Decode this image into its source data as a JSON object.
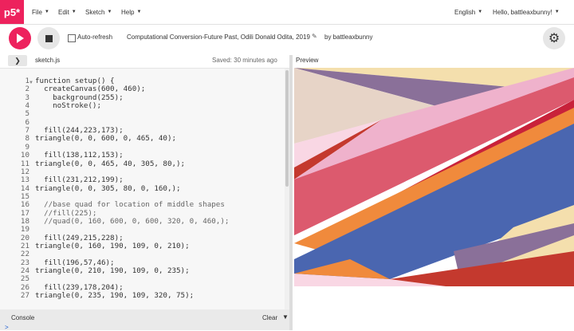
{
  "app": {
    "logo": "p5*"
  },
  "menu": {
    "file": "File",
    "edit": "Edit",
    "sketch": "Sketch",
    "help": "Help",
    "language": "English",
    "user": "Hello, battleaxbunny!"
  },
  "toolbar": {
    "auto_refresh": "Auto-refresh",
    "sketch_title": "Computational Conversion-Future Past, Odili Donald Odita, 2019",
    "byline": "by battleaxbunny"
  },
  "editor": {
    "filename": "sketch.js",
    "saved": "Saved: 30 minutes ago",
    "lines": [
      {
        "n": "1",
        "t": "function setup() {"
      },
      {
        "n": "2",
        "t": "  createCanvas(600, 460);"
      },
      {
        "n": "3",
        "t": "    background(255);"
      },
      {
        "n": "4",
        "t": "    noStroke();"
      },
      {
        "n": "5",
        "t": ""
      },
      {
        "n": "6",
        "t": ""
      },
      {
        "n": "7",
        "t": "  fill(244,223,173);"
      },
      {
        "n": "8",
        "t": "triangle(0, 0, 600, 0, 465, 40);"
      },
      {
        "n": "9",
        "t": ""
      },
      {
        "n": "10",
        "t": "  fill(138,112,153);"
      },
      {
        "n": "11",
        "t": "triangle(0, 0, 465, 40, 305, 80,);"
      },
      {
        "n": "12",
        "t": ""
      },
      {
        "n": "13",
        "t": "  fill(231,212,199);"
      },
      {
        "n": "14",
        "t": "triangle(0, 0, 305, 80, 0, 160,);"
      },
      {
        "n": "15",
        "t": ""
      },
      {
        "n": "16",
        "t": "  //base quad for location of middle shapes"
      },
      {
        "n": "17",
        "t": "  //fill(225);"
      },
      {
        "n": "18",
        "t": "  //quad(0, 160, 600, 0, 600, 320, 0, 460,);"
      },
      {
        "n": "19",
        "t": ""
      },
      {
        "n": "20",
        "t": "  fill(249,215,228);"
      },
      {
        "n": "21",
        "t": "triangle(0, 160, 190, 109, 0, 210);"
      },
      {
        "n": "22",
        "t": ""
      },
      {
        "n": "23",
        "t": "  fill(196,57,46);"
      },
      {
        "n": "24",
        "t": "triangle(0, 210, 190, 109, 0, 235);"
      },
      {
        "n": "25",
        "t": ""
      },
      {
        "n": "26",
        "t": "  fill(239,178,204);"
      },
      {
        "n": "27",
        "t": "triangle(0, 235, 190, 109, 320, 75);"
      }
    ]
  },
  "preview": {
    "label": "Preview"
  },
  "console": {
    "label": "Console",
    "clear": "Clear",
    "prompt": ">"
  },
  "colors": {
    "accent": "#ed225d",
    "cream": "#f4dfad",
    "purple": "#8a7099",
    "beige": "#e7d4c7",
    "pink_light": "#f9d7e4",
    "red_dark": "#c4392e",
    "pink": "#efb2cc",
    "rose": "#dc5a6e",
    "crimson": "#c8223a",
    "orange": "#f08a3c",
    "blue": "#4a66b0"
  },
  "icons": [
    "play-icon",
    "stop-icon",
    "gear-icon",
    "pencil-icon",
    "chevron-right-icon",
    "chevron-down-icon"
  ]
}
